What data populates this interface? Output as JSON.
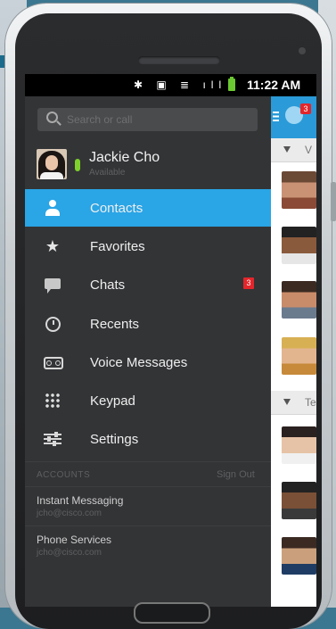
{
  "status_bar": {
    "icons_text": "✱ ▣ ≣ ıll",
    "time": "11:22 AM"
  },
  "search": {
    "placeholder": "Search or call"
  },
  "profile": {
    "name": "Jackie Cho",
    "status": "Available"
  },
  "menu": [
    {
      "label": "Contacts",
      "icon": "contacts-icon",
      "active": true
    },
    {
      "label": "Favorites",
      "icon": "star-icon"
    },
    {
      "label": "Chats",
      "icon": "chat-icon",
      "badge": "3"
    },
    {
      "label": "Recents",
      "icon": "recents-icon"
    },
    {
      "label": "Voice Messages",
      "icon": "voicemail-icon"
    },
    {
      "label": "Keypad",
      "icon": "keypad-icon"
    },
    {
      "label": "Settings",
      "icon": "settings-icon"
    }
  ],
  "accounts": {
    "title": "ACCOUNTS",
    "sign_out": "Sign Out",
    "items": [
      {
        "name": "Instant Messaging",
        "email": "jcho@cisco.com"
      },
      {
        "name": "Phone Services",
        "email": "jcho@cisco.com"
      }
    ]
  },
  "contacts_panel": {
    "badge": "3",
    "groups": [
      "V",
      "Te"
    ]
  },
  "colors": {
    "accent": "#2aa5e6",
    "badge": "#e3262b",
    "presence": "#7fd22c",
    "drawer_bg": "#333436"
  }
}
